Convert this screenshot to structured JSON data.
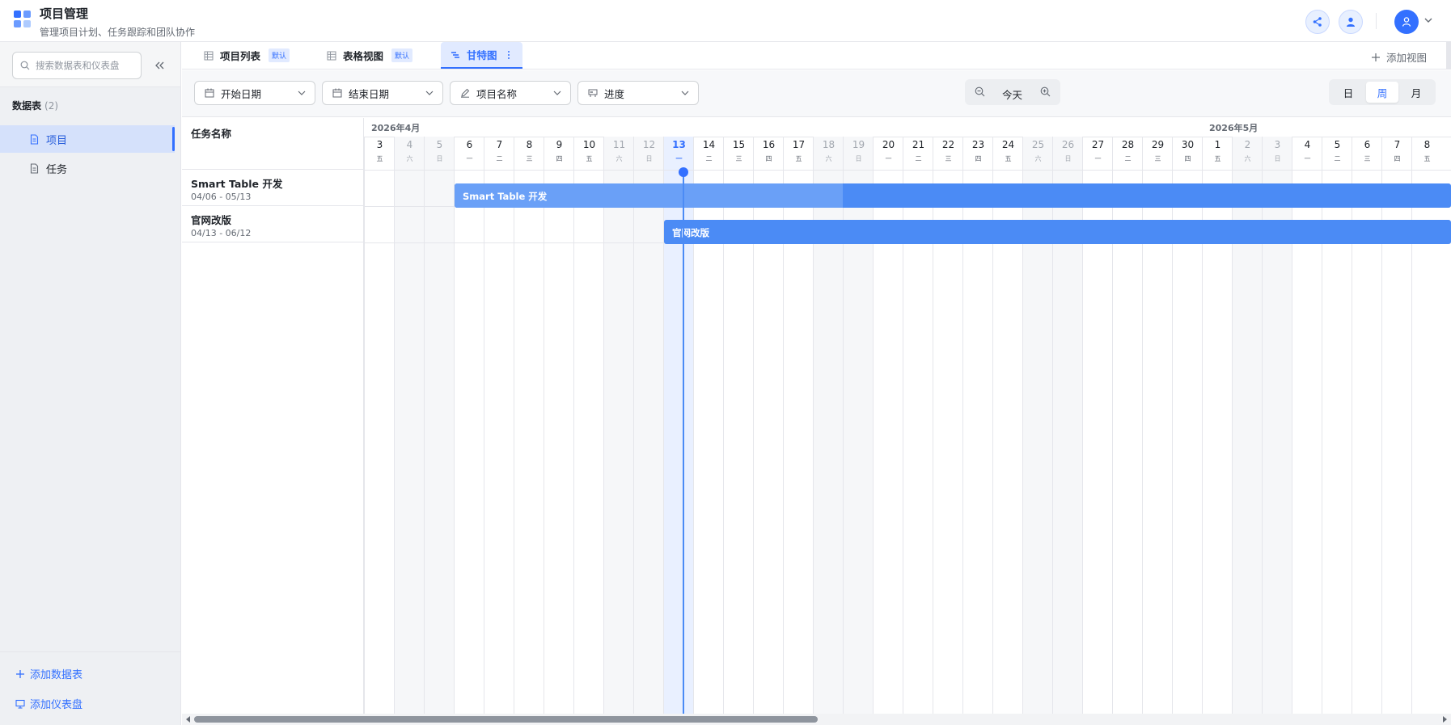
{
  "header": {
    "title": "项目管理",
    "subtitle": "管理项目计划、任务跟踪和团队协作"
  },
  "sidebar": {
    "search_placeholder": "搜索数据表和仪表盘",
    "section_title": "数据表",
    "section_count": "(2)",
    "items": [
      {
        "label": "项目",
        "active": true
      },
      {
        "label": "任务",
        "active": false
      }
    ],
    "add_table": "添加数据表",
    "add_dashboard": "添加仪表盘"
  },
  "tabs": [
    {
      "label": "项目列表",
      "badge": "默认",
      "icon": "grid-icon"
    },
    {
      "label": "表格视图",
      "badge": "默认",
      "icon": "grid-icon"
    },
    {
      "label": "甘特图",
      "badge": "",
      "icon": "gantt-icon",
      "active": true
    }
  ],
  "add_view_label": "添加视图",
  "toolbar": {
    "filters": [
      {
        "label": "开始日期",
        "icon": "calendar-icon"
      },
      {
        "label": "结束日期",
        "icon": "calendar-icon"
      },
      {
        "label": "项目名称",
        "icon": "edit-icon"
      },
      {
        "label": "进度",
        "icon": "progress-icon"
      }
    ],
    "today_label": "今天",
    "scales": [
      {
        "label": "日",
        "selected": false
      },
      {
        "label": "周",
        "selected": true
      },
      {
        "label": "月",
        "selected": false
      }
    ]
  },
  "gantt": {
    "task_header": "任务名称",
    "months": [
      {
        "label": "2026年4月",
        "start_index": 0
      },
      {
        "label": "2026年5月",
        "start_index": 28
      }
    ],
    "days": [
      {
        "d": "3",
        "w": "五",
        "weekend": false
      },
      {
        "d": "4",
        "w": "六",
        "weekend": true
      },
      {
        "d": "5",
        "w": "日",
        "weekend": true
      },
      {
        "d": "6",
        "w": "一",
        "weekend": false
      },
      {
        "d": "7",
        "w": "二",
        "weekend": false
      },
      {
        "d": "8",
        "w": "三",
        "weekend": false
      },
      {
        "d": "9",
        "w": "四",
        "weekend": false
      },
      {
        "d": "10",
        "w": "五",
        "weekend": false
      },
      {
        "d": "11",
        "w": "六",
        "weekend": true
      },
      {
        "d": "12",
        "w": "日",
        "weekend": true
      },
      {
        "d": "13",
        "w": "一",
        "weekend": false,
        "today": true
      },
      {
        "d": "14",
        "w": "二",
        "weekend": false
      },
      {
        "d": "15",
        "w": "三",
        "weekend": false
      },
      {
        "d": "16",
        "w": "四",
        "weekend": false
      },
      {
        "d": "17",
        "w": "五",
        "weekend": false
      },
      {
        "d": "18",
        "w": "六",
        "weekend": true
      },
      {
        "d": "19",
        "w": "日",
        "weekend": true
      },
      {
        "d": "20",
        "w": "一",
        "weekend": false
      },
      {
        "d": "21",
        "w": "二",
        "weekend": false
      },
      {
        "d": "22",
        "w": "三",
        "weekend": false
      },
      {
        "d": "23",
        "w": "四",
        "weekend": false
      },
      {
        "d": "24",
        "w": "五",
        "weekend": false
      },
      {
        "d": "25",
        "w": "六",
        "weekend": true
      },
      {
        "d": "26",
        "w": "日",
        "weekend": true
      },
      {
        "d": "27",
        "w": "一",
        "weekend": false
      },
      {
        "d": "28",
        "w": "二",
        "weekend": false
      },
      {
        "d": "29",
        "w": "三",
        "weekend": false
      },
      {
        "d": "30",
        "w": "四",
        "weekend": false
      },
      {
        "d": "1",
        "w": "五",
        "weekend": false
      },
      {
        "d": "2",
        "w": "六",
        "weekend": true
      },
      {
        "d": "3",
        "w": "日",
        "weekend": true
      },
      {
        "d": "4",
        "w": "一",
        "weekend": false
      },
      {
        "d": "5",
        "w": "二",
        "weekend": false
      },
      {
        "d": "6",
        "w": "三",
        "weekend": false
      },
      {
        "d": "7",
        "w": "四",
        "weekend": false
      },
      {
        "d": "8",
        "w": "五",
        "weekend": false
      }
    ],
    "tasks": [
      {
        "name": "Smart Table 开发",
        "dates": "04/06 - 05/13",
        "start_index": 3,
        "progress": 0.39
      },
      {
        "name": "官网改版",
        "dates": "04/13 - 06/12",
        "start_index": 10,
        "progress": 0
      }
    ]
  },
  "colors": {
    "accent": "#3370ff",
    "bar": "#4b8bf5",
    "bar_progress": "#6aa0f7"
  }
}
